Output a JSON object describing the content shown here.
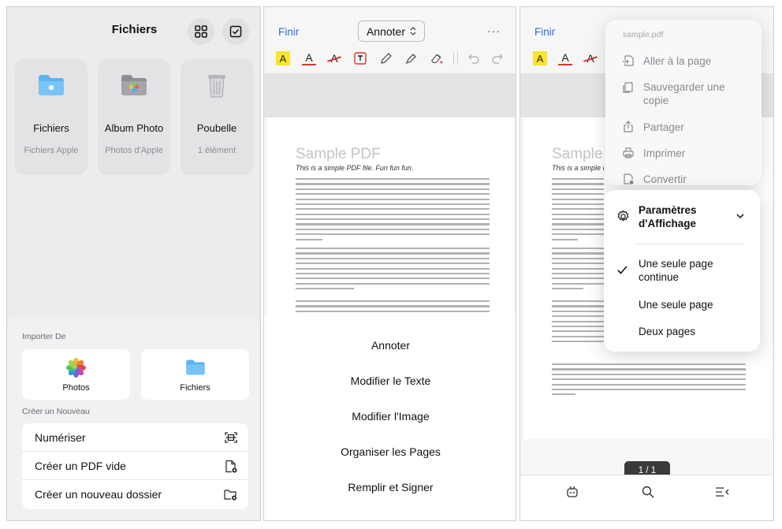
{
  "files": {
    "title": "Fichiers",
    "tiles": [
      {
        "name": "Fichiers",
        "sub": "Fichiers Apple"
      },
      {
        "name": "Album Photo",
        "sub": "Photos d'Apple"
      },
      {
        "name": "Poubelle",
        "sub": "1 élément"
      }
    ],
    "import_title": "Importer De",
    "import_items": [
      "Photos",
      "Fichiers"
    ],
    "create_title": "Créer un Nouveau",
    "create_items": [
      "Numériser",
      "Créer un PDF vide",
      "Créer un nouveau dossier"
    ]
  },
  "editor": {
    "done_label": "Finir",
    "mode_label": "Annoter",
    "more_label": "···",
    "doc_title": "Sample PDF",
    "doc_subtitle": "This is a simple PDF file. Fun fun fun.",
    "doc_title_partial": "Sample P",
    "actions": [
      "Annoter",
      "Modifier le Texte",
      "Modifier l'Image",
      "Organiser les Pages",
      "Remplir et Signer"
    ]
  },
  "viewer": {
    "done_label": "Finir",
    "menu_title": "sample.pdf",
    "menu_items": [
      "Aller à la page",
      "Sauvegarder une copie",
      "Partager",
      "Imprimer",
      "Convertir"
    ],
    "display_title": "Paramètres d'Affichage",
    "display_options": [
      "Une seule page continue",
      "Une seule page",
      "Deux pages"
    ],
    "selected_option": 0,
    "page_indicator": "1 / 1"
  },
  "colors": {
    "accent": "#2f6ed6",
    "highlight": "#f9e52a",
    "red": "#d9362f",
    "folder": "#5ab3f2"
  },
  "icons": [
    "grid-icon",
    "select-check-icon",
    "folder-icon",
    "photos-icon",
    "trash-icon",
    "scan-icon",
    "new-pdf-icon",
    "new-folder-icon",
    "highlighter-icon",
    "text-color-icon",
    "strikethrough-icon",
    "textbox-icon",
    "pen-icon",
    "marker-icon",
    "eraser-icon",
    "undo-icon",
    "redo-icon",
    "goto-page-icon",
    "copy-icon",
    "share-icon",
    "print-icon",
    "convert-icon",
    "settings-icon",
    "chevron-down-icon",
    "checkmark-icon",
    "robot-icon",
    "search-icon",
    "outline-icon"
  ]
}
